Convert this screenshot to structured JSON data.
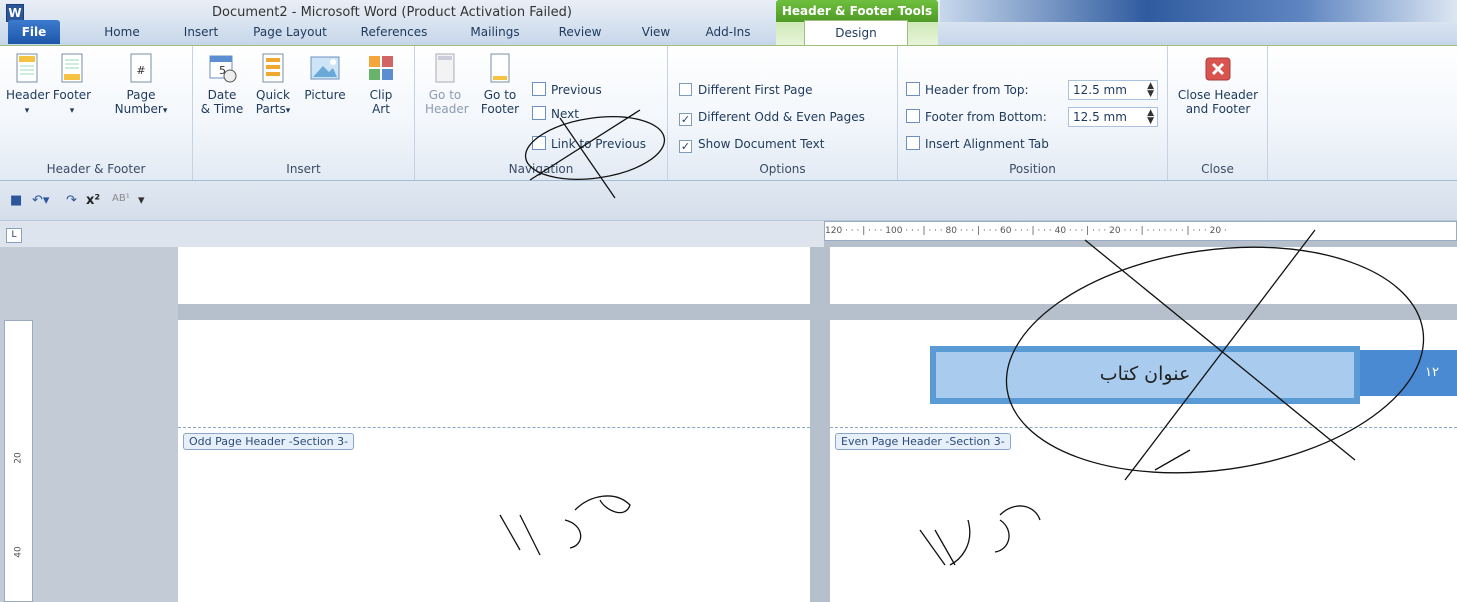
{
  "window": {
    "title": "Document2  -  Microsoft Word (Product Activation Failed)",
    "app_icon": "W"
  },
  "context_tab": {
    "title": "Header & Footer Tools"
  },
  "tabs": [
    {
      "label": "File"
    },
    {
      "label": "Home"
    },
    {
      "label": "Insert"
    },
    {
      "label": "Page Layout"
    },
    {
      "label": "References"
    },
    {
      "label": "Mailings"
    },
    {
      "label": "Review"
    },
    {
      "label": "View"
    },
    {
      "label": "Add-Ins"
    },
    {
      "label": "Design"
    }
  ],
  "ribbon": {
    "header_footer": {
      "label": "Header & Footer",
      "header": "Header",
      "footer": "Footer",
      "page": "Page",
      "number": "Number"
    },
    "insert": {
      "label": "Insert",
      "date": "Date",
      "time": "& Time",
      "quick": "Quick",
      "parts": "Parts",
      "picture": "Picture",
      "clip": "Clip",
      "art": "Art"
    },
    "navigation": {
      "label": "Navigation",
      "goto1": "Go to",
      "header": "Header",
      "goto2": "Go to",
      "footer": "Footer",
      "previous": "Previous",
      "next": "Next",
      "link_previous": "Link to Previous"
    },
    "options": {
      "label": "Options",
      "different_first": "Different First Page",
      "different_odd_even": "Different Odd & Even Pages",
      "show_doc_text": "Show Document Text",
      "checked": {
        "different_first": false,
        "different_odd_even": true,
        "show_doc_text": true
      }
    },
    "position": {
      "label": "Position",
      "header_from_top": "Header from Top:",
      "header_value": "12.5 mm",
      "footer_from_bottom": "Footer from Bottom:",
      "footer_value": "12.5 mm",
      "insert_align_tab": "Insert Alignment Tab"
    },
    "close": {
      "label": "Close",
      "line1": "Close Header",
      "line2": "and Footer"
    }
  },
  "ruler": {
    "top_text": "120 · · · | · · · 100 · · · | · · · 80 · · · | · · · 60 · · · | · · · 40 · · · | · · · 20 · · · | · · · · · · · | · · · 20 ·",
    "left_marks": [
      "20",
      "40"
    ]
  },
  "document": {
    "odd_header_tag": "Odd Page Header -Section 3-",
    "even_header_tag": "Even Page Header -Section 3-",
    "book_title": "عنوان کتاب",
    "page_number": "۱۲"
  }
}
